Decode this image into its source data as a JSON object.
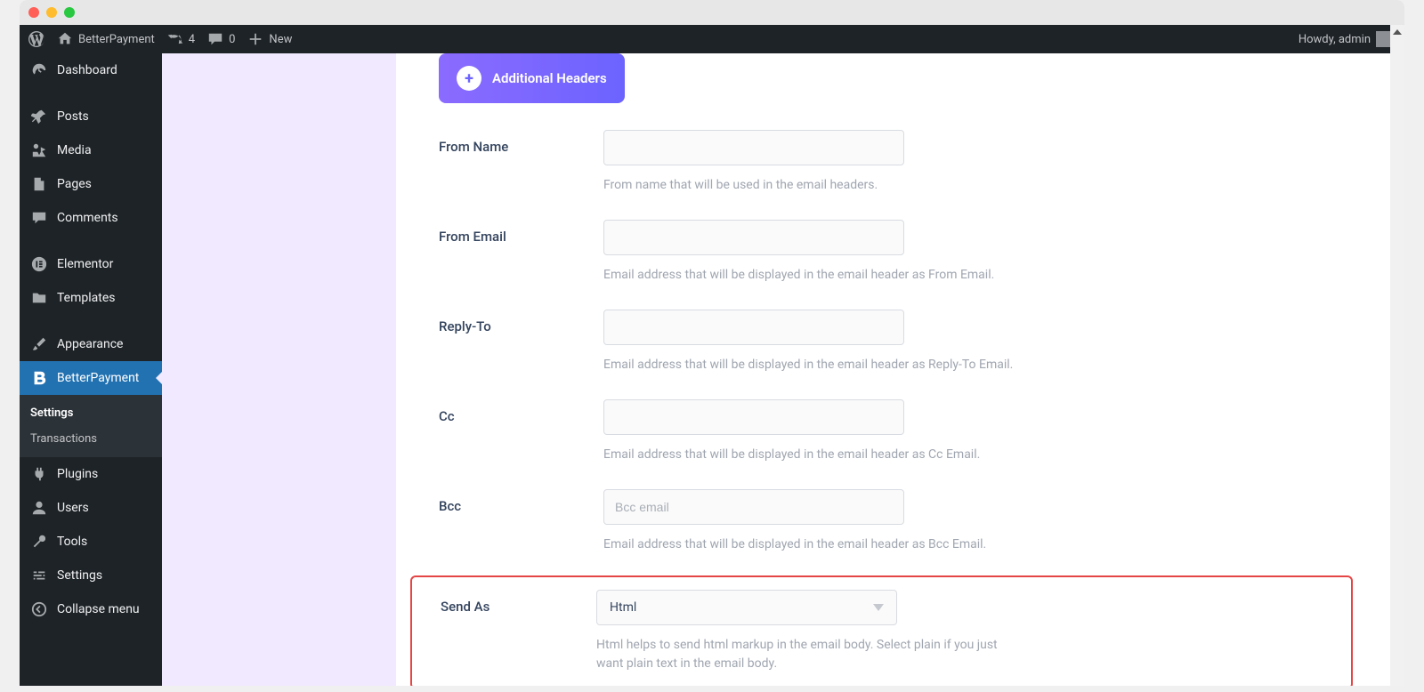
{
  "adminbar": {
    "site_name": "BetterPayment",
    "updates_count": "4",
    "comments_count": "0",
    "new_label": "New",
    "howdy": "Howdy, admin"
  },
  "sidebar": {
    "dashboard": "Dashboard",
    "posts": "Posts",
    "media": "Media",
    "pages": "Pages",
    "comments": "Comments",
    "elementor": "Elementor",
    "templates": "Templates",
    "appearance": "Appearance",
    "betterpayment": "BetterPayment",
    "plugins": "Plugins",
    "users": "Users",
    "tools": "Tools",
    "settings": "Settings",
    "collapse": "Collapse menu",
    "sub_settings": "Settings",
    "sub_transactions": "Transactions"
  },
  "form": {
    "headers_btn": "Additional Headers",
    "from_name_label": "From Name",
    "from_name_hint": "From name that will be used in the email headers.",
    "from_email_label": "From Email",
    "from_email_hint": "Email address that will be displayed in the email header as From Email.",
    "reply_to_label": "Reply-To",
    "reply_to_hint": "Email address that will be displayed in the email header as Reply-To Email.",
    "cc_label": "Cc",
    "cc_hint": "Email address that will be displayed in the email header as Cc Email.",
    "bcc_label": "Bcc",
    "bcc_placeholder": "Bcc email",
    "bcc_hint": "Email address that will be displayed in the email header as Bcc Email.",
    "send_as_label": "Send As",
    "send_as_value": "Html",
    "send_as_hint": "Html helps to send html markup in the email body. Select plain if you just want plain text in the email body."
  }
}
